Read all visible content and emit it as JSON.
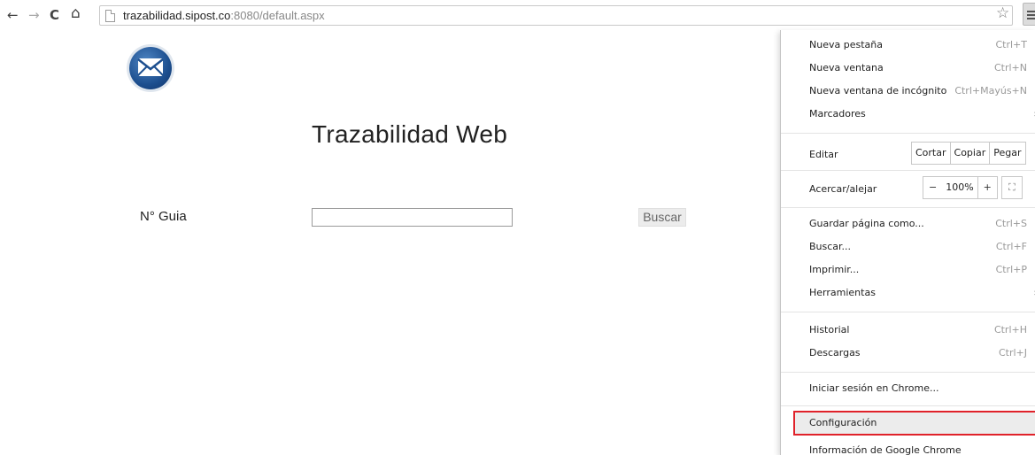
{
  "browser": {
    "url_host": "trazabilidad.sipost.co",
    "url_rest": ":8080/default.aspx",
    "icons": {
      "back": "←",
      "forward": "→",
      "reload": "C",
      "home": "⌂",
      "star": "☆"
    }
  },
  "page": {
    "title": "Trazabilidad Web",
    "guide_label": "N° Guia",
    "guide_value": "",
    "search_button": "Buscar"
  },
  "menu": {
    "new_tab": {
      "label": "Nueva pestaña",
      "shortcut": "Ctrl+T"
    },
    "new_window": {
      "label": "Nueva ventana",
      "shortcut": "Ctrl+N"
    },
    "incognito": {
      "label": "Nueva ventana de incógnito",
      "shortcut": "Ctrl+Mayús+N"
    },
    "bookmarks": {
      "label": "Marcadores"
    },
    "edit": {
      "label": "Editar",
      "cut": "Cortar",
      "copy": "Copiar",
      "paste": "Pegar"
    },
    "zoom": {
      "label": "Acercar/alejar",
      "minus": "−",
      "value": "100%",
      "plus": "+",
      "fullscreen": "⛶"
    },
    "save_as": {
      "label": "Guardar página como...",
      "shortcut": "Ctrl+S"
    },
    "find": {
      "label": "Buscar...",
      "shortcut": "Ctrl+F"
    },
    "print": {
      "label": "Imprimir...",
      "shortcut": "Ctrl+P"
    },
    "tools": {
      "label": "Herramientas"
    },
    "history": {
      "label": "Historial",
      "shortcut": "Ctrl+H"
    },
    "downloads": {
      "label": "Descargas",
      "shortcut": "Ctrl+J"
    },
    "signin": {
      "label": "Iniciar sesión en Chrome..."
    },
    "settings": {
      "label": "Configuración"
    },
    "about": {
      "label": "Información de Google Chrome"
    }
  },
  "colors": {
    "highlight_border": "#e0222a",
    "logo_blue": "#1d4f8f"
  }
}
